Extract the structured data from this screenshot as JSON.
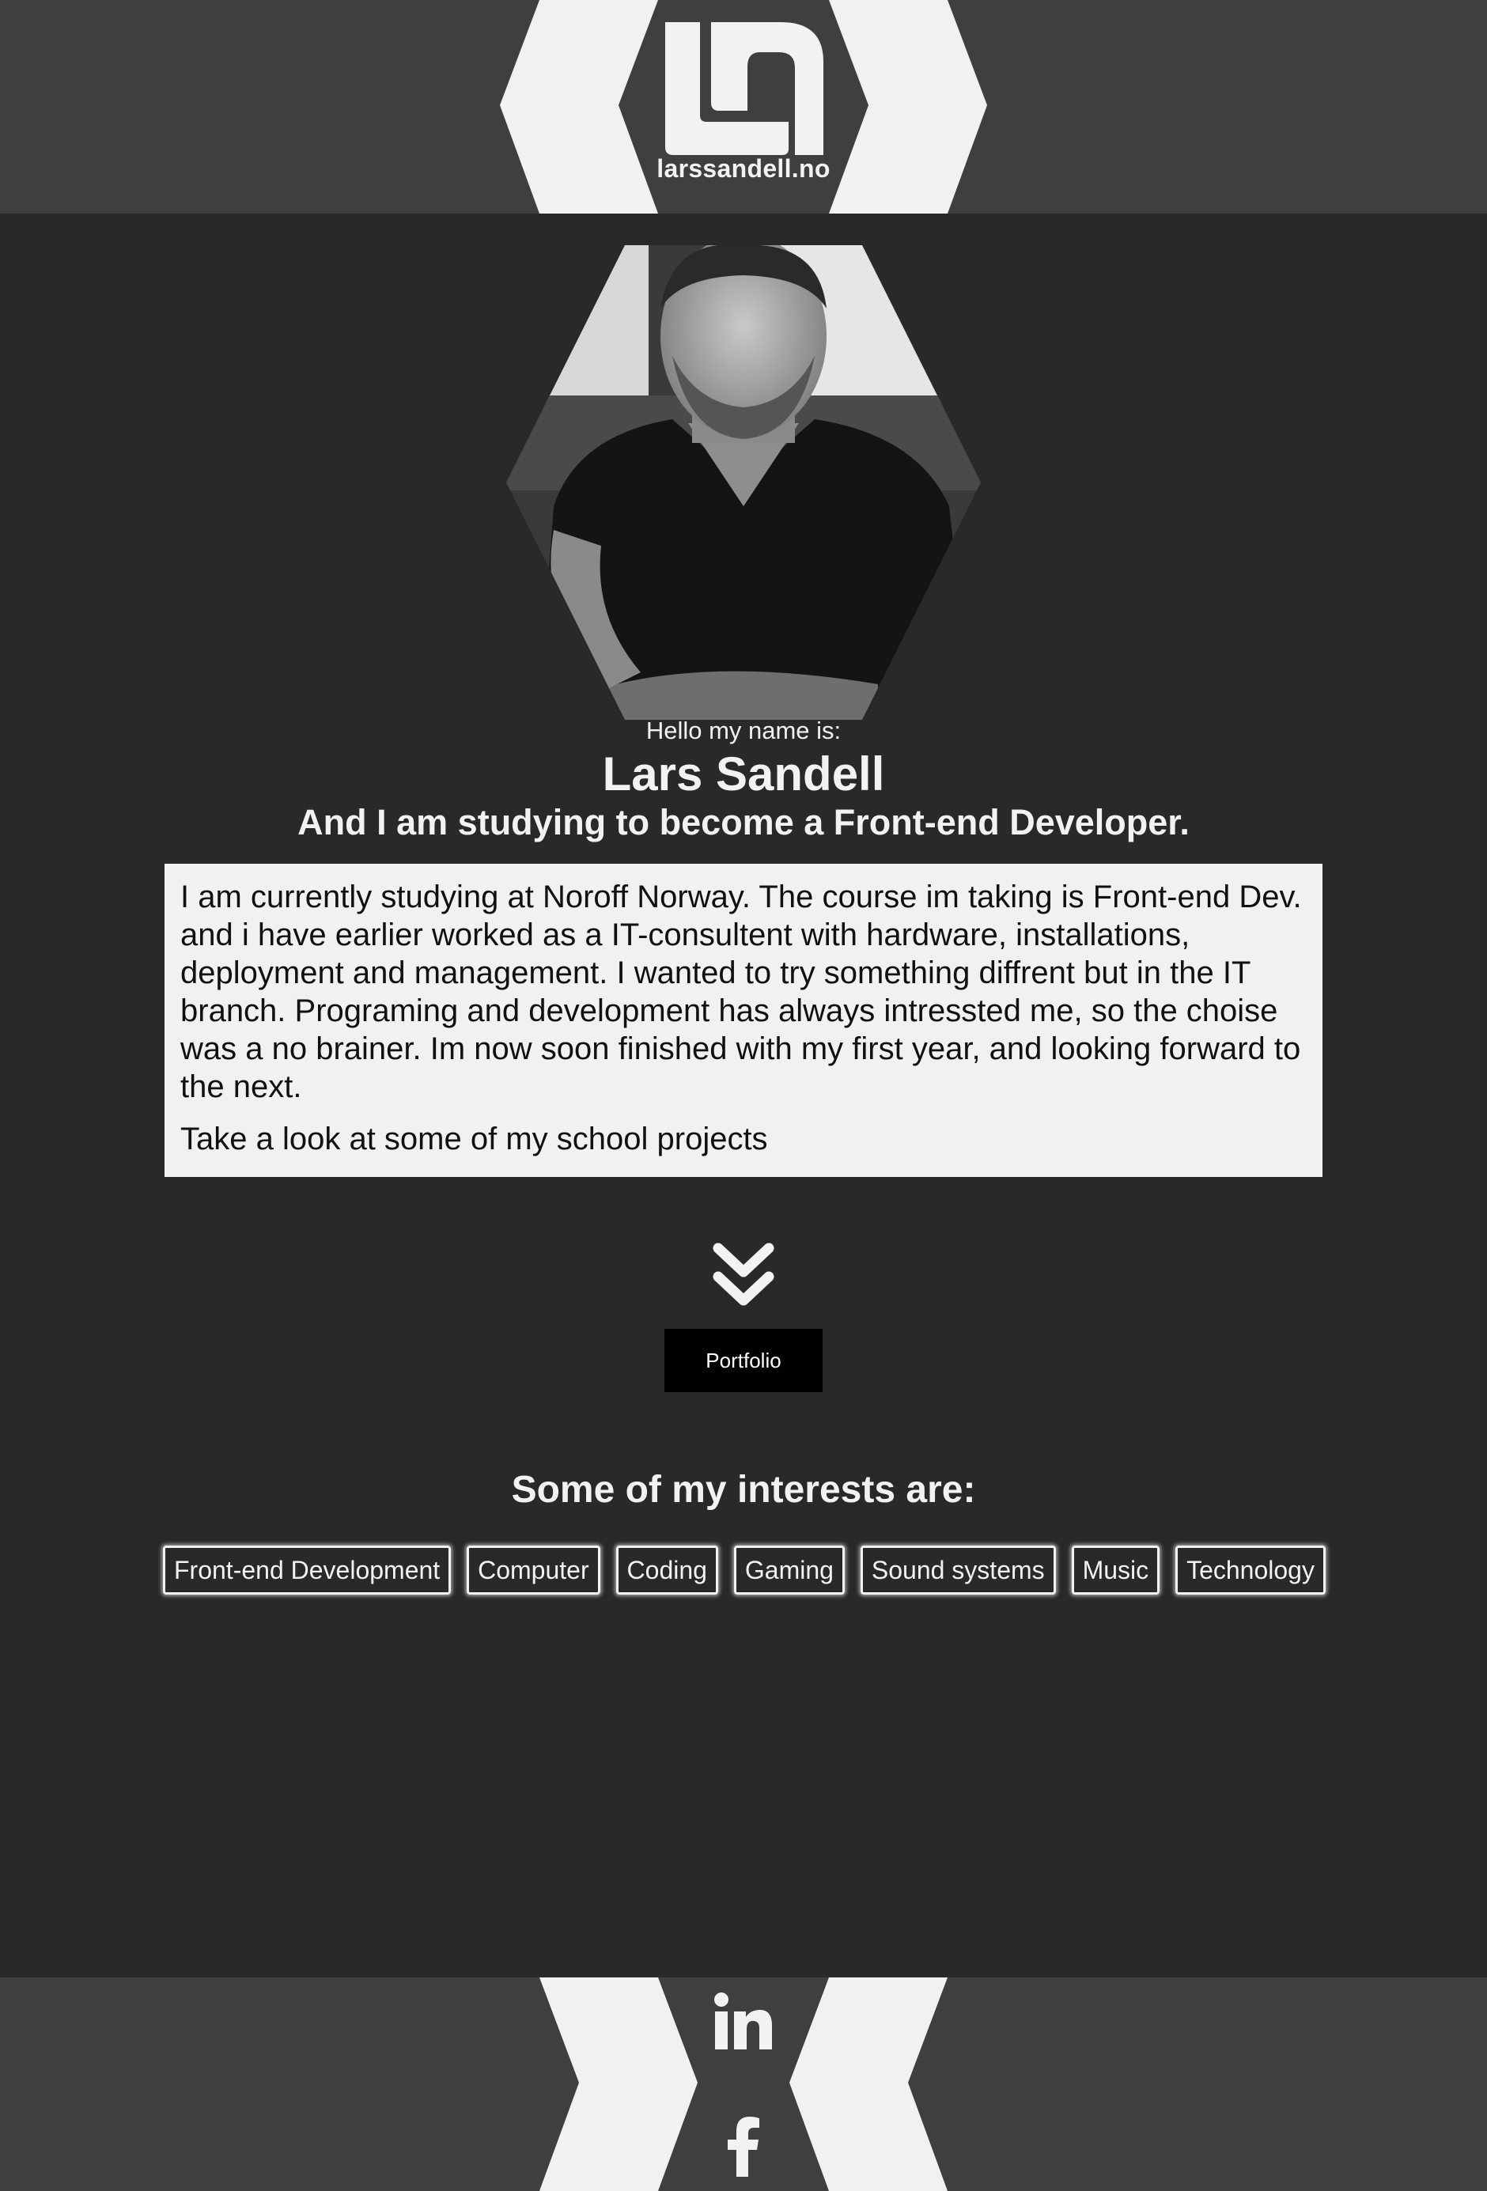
{
  "header": {
    "site_name": "larssandell.no",
    "logo_icon": "ls-monogram-logo"
  },
  "hero": {
    "photo": "portrait-photo",
    "greeting": "Hello my name is:",
    "name": "Lars Sandell",
    "tagline": "And I am studying to become a Front-end Developer."
  },
  "about": {
    "paragraph_1": "I am currently studying at Noroff Norway. The course im taking is Front-end Dev. and i have earlier worked as a IT-consultent with hardware, installations, deployment and management. I wanted to try something diffrent but in the IT branch. Programing and development has always intressted me, so the choise was a no brainer. Im now soon finished with my first year, and looking forward to the next.",
    "paragraph_2": "Take a look at some of my school projects"
  },
  "portfolio": {
    "icon": "double-chevron-down-icon",
    "button_label": "Portfolio"
  },
  "interests": {
    "title": "Some of my interests are:",
    "items": [
      "Front-end Development",
      "Computer",
      "Coding",
      "Gaming",
      "Sound systems",
      "Music",
      "Technology"
    ]
  },
  "footer": {
    "icons": [
      "linkedin-icon",
      "facebook-icon"
    ]
  },
  "colors": {
    "header_bg": "#3f3f3f",
    "page_bg": "#292929",
    "light": "#f2f2f2",
    "button_bg": "#000000"
  }
}
